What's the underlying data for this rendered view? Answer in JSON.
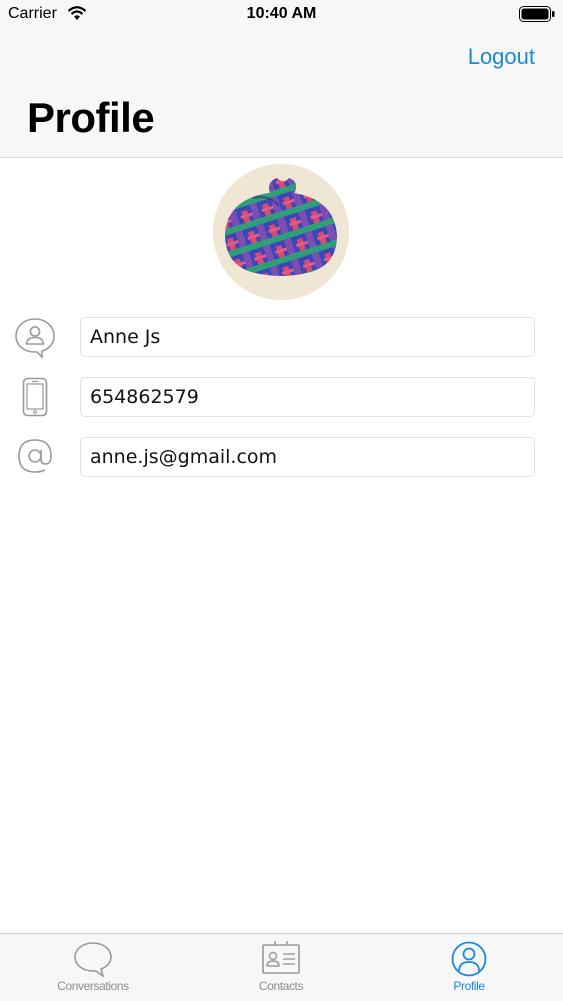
{
  "status_bar": {
    "carrier": "Carrier",
    "time": "10:40 AM"
  },
  "header": {
    "title": "Profile",
    "logout_label": "Logout"
  },
  "profile": {
    "name": "Anne Js",
    "phone": "654862579",
    "email": "anne.js@gmail.com"
  },
  "tabs": [
    {
      "label": "Conversations",
      "icon": "chat-bubble-icon",
      "active": false
    },
    {
      "label": "Contacts",
      "icon": "contact-card-icon",
      "active": false
    },
    {
      "label": "Profile",
      "icon": "profile-icon",
      "active": true
    }
  ],
  "colors": {
    "accent": "#1a8ad8",
    "inactive": "#8e8e93",
    "bar_background": "#f7f7f7"
  }
}
